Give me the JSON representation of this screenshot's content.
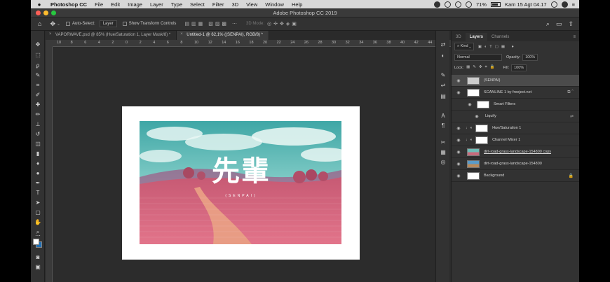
{
  "menubar": {
    "app_name": "Photoshop CC",
    "items": [
      "File",
      "Edit",
      "Image",
      "Layer",
      "Type",
      "Select",
      "Filter",
      "3D",
      "View",
      "Window",
      "Help"
    ],
    "battery": "71%",
    "datetime": "Kam 15 Agt 04.17"
  },
  "window": {
    "title": "Adobe Photoshop CC 2019"
  },
  "options": {
    "auto_select": "Auto-Select:",
    "target": "Layer",
    "show_transform": "Show Transform Controls",
    "mode_3d": "3D Mode:"
  },
  "tabs": [
    {
      "label": "VAPORWAVE.psd @ 85% (Hue/Saturation 1, Layer Mask/8) *",
      "active": false
    },
    {
      "label": "Untitled-1 @ 62,1% ((SENPAI), RGB/8) *",
      "active": true
    }
  ],
  "ruler": {
    "ticks": [
      "10",
      "8",
      "6",
      "4",
      "2",
      "0",
      "2",
      "4",
      "6",
      "8",
      "10",
      "12",
      "14",
      "16",
      "18",
      "20",
      "22",
      "24",
      "26",
      "28",
      "30",
      "32",
      "34",
      "36",
      "38",
      "40",
      "42",
      "44"
    ]
  },
  "artwork": {
    "headline": "先輩",
    "subline": "(SENPAI)"
  },
  "panel": {
    "tabs": [
      "3D",
      "Layers",
      "Channels"
    ],
    "active_tab": "Layers",
    "filter_kind": "Kind",
    "blend_mode": "Normal",
    "opacity_label": "Opacity:",
    "opacity": "100%",
    "lock_label": "Lock:",
    "fill_label": "Fill:",
    "fill": "100%",
    "layers": [
      {
        "name": "(SENPAI)",
        "type": "text",
        "active": true
      },
      {
        "name": "SCANLINE 1 by freeject.net",
        "type": "smart"
      },
      {
        "name": "Smart Filters",
        "type": "filters"
      },
      {
        "name": "Liquify",
        "type": "filter"
      },
      {
        "name": "Hue/Saturation 1",
        "type": "adjustment"
      },
      {
        "name": "Channel Mixer 1",
        "type": "adjustment"
      },
      {
        "name": "dirt-road-grass-landscape-154800 copy",
        "type": "image"
      },
      {
        "name": "dirt-road-grass-landscape-154800",
        "type": "image"
      },
      {
        "name": "Background",
        "type": "background"
      }
    ]
  },
  "colors": {
    "foreground": "#ffffff",
    "background": "#1f6fb5",
    "sky": "#5fb8b4",
    "grass": "#d9667e"
  }
}
